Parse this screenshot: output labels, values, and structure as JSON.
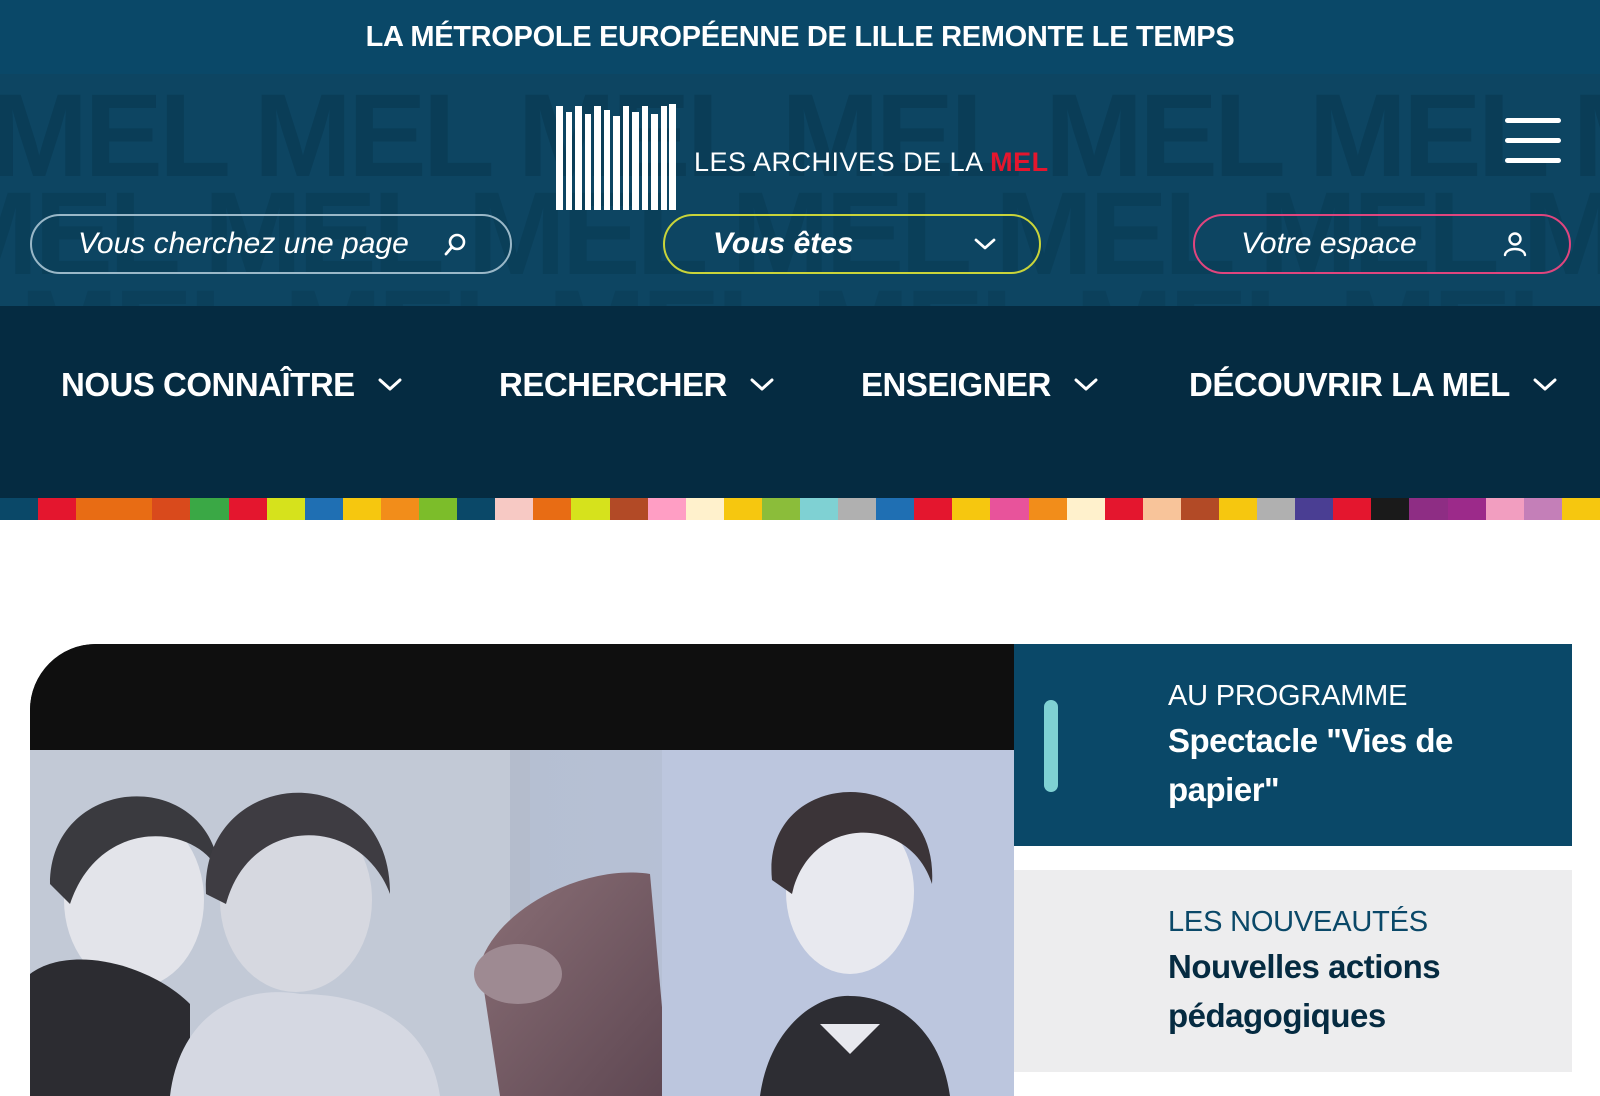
{
  "top_banner": {
    "text": "LA MÉTROPOLE EUROPÉENNE DE LILLE REMONTE LE TEMPS"
  },
  "header": {
    "pattern_word": "MEL",
    "logo": {
      "text": "LES ARCHIVES DE LA ",
      "accent": "MEL"
    },
    "menu_icon": "hamburger-icon",
    "search": {
      "placeholder": "Vous cherchez une page",
      "icon": "search-icon"
    },
    "profile_select": {
      "label": "Vous êtes",
      "icon": "chevron-down-icon"
    },
    "account": {
      "label": "Votre espace",
      "icon": "user-icon"
    }
  },
  "nav": {
    "items": [
      {
        "label": "NOUS CONNAÎTRE"
      },
      {
        "label": "RECHERCHER"
      },
      {
        "label": "ENSEIGNER"
      },
      {
        "label": "DÉCOUVRIR LA MEL"
      }
    ]
  },
  "color_strip": [
    "#0a4868",
    "#e4162e",
    "#e86c14",
    "#e86c14",
    "#d94a1c",
    "#3aa845",
    "#e4162e",
    "#d6e21c",
    "#1f6fb3",
    "#f6c70f",
    "#f28d1a",
    "#7cbd2a",
    "#0a4868",
    "#f7c9c4",
    "#e86c14",
    "#d6e21c",
    "#b24a26",
    "#ff9ec4",
    "#fff1cc",
    "#f6c70f",
    "#8bbd3a",
    "#7fd1d3",
    "#b0b0b0",
    "#1f6fb3",
    "#e4162e",
    "#f6c70f",
    "#e8539b",
    "#f28d1a",
    "#fff1cc",
    "#e4162e",
    "#f8c49a",
    "#b24a26",
    "#f6c70f",
    "#b0b0b0",
    "#4a3e93",
    "#e4162e",
    "#1a1a1a",
    "#8e2d84",
    "#9c2a8a",
    "#f29ec0",
    "#c47fb8",
    "#f6c70f"
  ],
  "colors": {
    "banner": "#0a4868",
    "header": "#0d4562",
    "nav": "#052b41",
    "mel_red": "#e4162e",
    "search_border": "#9ab8c8",
    "profile_border": "#c9d43a",
    "account_border": "#e0457e",
    "program_accent": "#7fd1d3",
    "news_bg": "#ededee"
  },
  "hero": {
    "alt": "vintage portrait photographs"
  },
  "cards": {
    "program": {
      "kicker": "AU PROGRAMME",
      "title": "Spectacle \"Vies de papier\""
    },
    "news": {
      "kicker": "LES NOUVEAUTÉS",
      "title": "Nouvelles actions pédagogiques"
    }
  }
}
